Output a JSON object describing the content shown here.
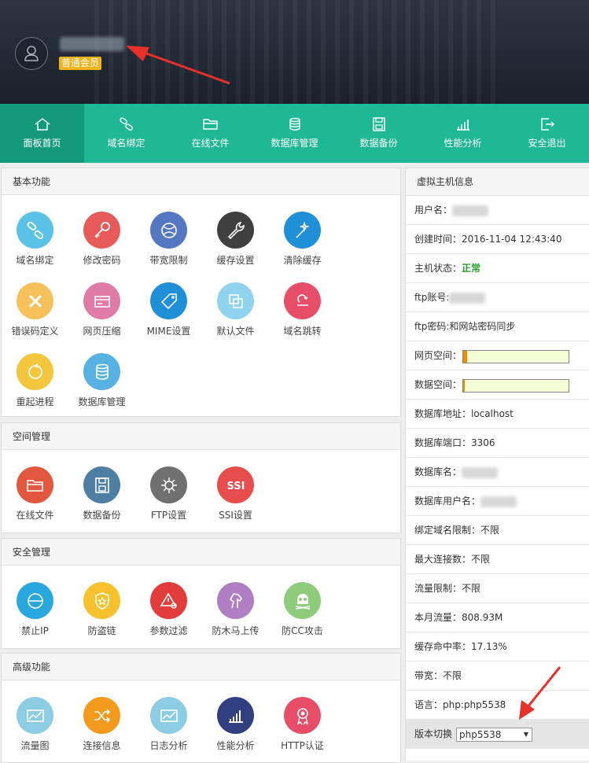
{
  "header": {
    "member_badge": "普通会员"
  },
  "nav": {
    "items": [
      {
        "label": "面板首页",
        "icon": "home-icon",
        "active": true
      },
      {
        "label": "域名绑定",
        "icon": "link-icon",
        "active": false
      },
      {
        "label": "在线文件",
        "icon": "folder-icon",
        "active": false
      },
      {
        "label": "数据库管理",
        "icon": "database-icon",
        "active": false
      },
      {
        "label": "数据备份",
        "icon": "save-icon",
        "active": false
      },
      {
        "label": "性能分析",
        "icon": "bar-chart-icon",
        "active": false
      },
      {
        "label": "安全退出",
        "icon": "logout-icon",
        "active": false
      }
    ]
  },
  "sections": [
    {
      "title": "基本功能",
      "items": [
        {
          "label": "域名绑定",
          "icon": "link-icon",
          "color": "#5bc2e7"
        },
        {
          "label": "修改密码",
          "icon": "key-icon",
          "color": "#e75a5a"
        },
        {
          "label": "带宽限制",
          "icon": "globe-icon",
          "color": "#5577c2"
        },
        {
          "label": "缓存设置",
          "icon": "wrench-icon",
          "color": "#3f3f3f"
        },
        {
          "label": "清除缓存",
          "icon": "magic-wand-icon",
          "color": "#1f8fd8"
        },
        {
          "label": "错误码定义",
          "icon": "x-mark-icon",
          "color": "#f6c15b"
        },
        {
          "label": "网页压缩",
          "icon": "card-icon",
          "color": "#e07aa6"
        },
        {
          "label": "MIME设置",
          "icon": "tag-icon",
          "color": "#1f8fd8"
        },
        {
          "label": "默认文件",
          "icon": "copy-icon",
          "color": "#8fd3ef"
        },
        {
          "label": "域名跳转",
          "icon": "redirect-icon",
          "color": "#e84d68"
        },
        {
          "label": "重起进程",
          "icon": "restart-icon",
          "color": "#f3c63b"
        },
        {
          "label": "数据库管理",
          "icon": "database-icon",
          "color": "#58b1e3"
        }
      ]
    },
    {
      "title": "空间管理",
      "items": [
        {
          "label": "在线文件",
          "icon": "folder-open-icon",
          "color": "#e3573f"
        },
        {
          "label": "数据备份",
          "icon": "floppy-icon",
          "color": "#4e7fa3"
        },
        {
          "label": "FTP设置",
          "icon": "ftp-icon",
          "color": "#707070"
        },
        {
          "label": "SSI设置",
          "icon": "ssi-icon",
          "color": "#e84d4d"
        }
      ]
    },
    {
      "title": "安全管理",
      "items": [
        {
          "label": "禁止IP",
          "icon": "block-icon",
          "color": "#29a8e0"
        },
        {
          "label": "防盗链",
          "icon": "shield-star-icon",
          "color": "#f6c12c"
        },
        {
          "label": "参数过滤",
          "icon": "warning-filter-icon",
          "color": "#e23c3c"
        },
        {
          "label": "防木马上传",
          "icon": "horse-icon",
          "color": "#b07ec3"
        },
        {
          "label": "防CC攻击",
          "icon": "skull-icon",
          "color": "#8ecb7a"
        }
      ]
    },
    {
      "title": "高级功能",
      "items": [
        {
          "label": "流量图",
          "icon": "traffic-chart-icon",
          "color": "#8ccde3"
        },
        {
          "label": "连接信息",
          "icon": "shuffle-icon",
          "color": "#f39a1c"
        },
        {
          "label": "日志分析",
          "icon": "log-chart-icon",
          "color": "#8ccde3"
        },
        {
          "label": "性能分析",
          "icon": "bar-chart-icon",
          "color": "#2f3f7f"
        },
        {
          "label": "HTTP认证",
          "icon": "ribbon-icon",
          "color": "#e84d68"
        }
      ]
    }
  ],
  "info": {
    "title": "虚拟主机信息",
    "username_label": "用户名：",
    "created_label": "创建时间：2016-11-04 12:43:40",
    "status_label": "主机状态：",
    "status_value": "正常",
    "ftp_account_label": "ftp账号:",
    "ftp_password_label": "ftp密码:和网站密码同步",
    "web_space_label": "网页空间：",
    "web_space_usage": 0.04,
    "db_space_label": "数据空间：",
    "db_space_usage": 0.015,
    "db_address_label": "数据库地址：localhost",
    "db_port_label": "数据库端口：3306",
    "db_name_label": "数据库名：",
    "db_user_label": "数据库用户名：",
    "domain_limit_label": "绑定域名限制：不限",
    "max_conn_label": "最大连接数：不限",
    "traffic_limit_label": "流量限制：不限",
    "monthly_traffic_label": "本月流量：808.93M",
    "cache_hit_label": "缓存命中率：17.13%",
    "bandwidth_label": "带宽：不限",
    "language_label": "语言：php:php5538",
    "version_label": "版本切换",
    "version_value": "php5538"
  },
  "colors": {
    "nav_bg": "#1fb894",
    "nav_active": "#139a7a",
    "badge": "#f1b51c",
    "arrow": "#e8302a",
    "status_ok": "#27a12b",
    "bar_fill": "#f08c00"
  }
}
